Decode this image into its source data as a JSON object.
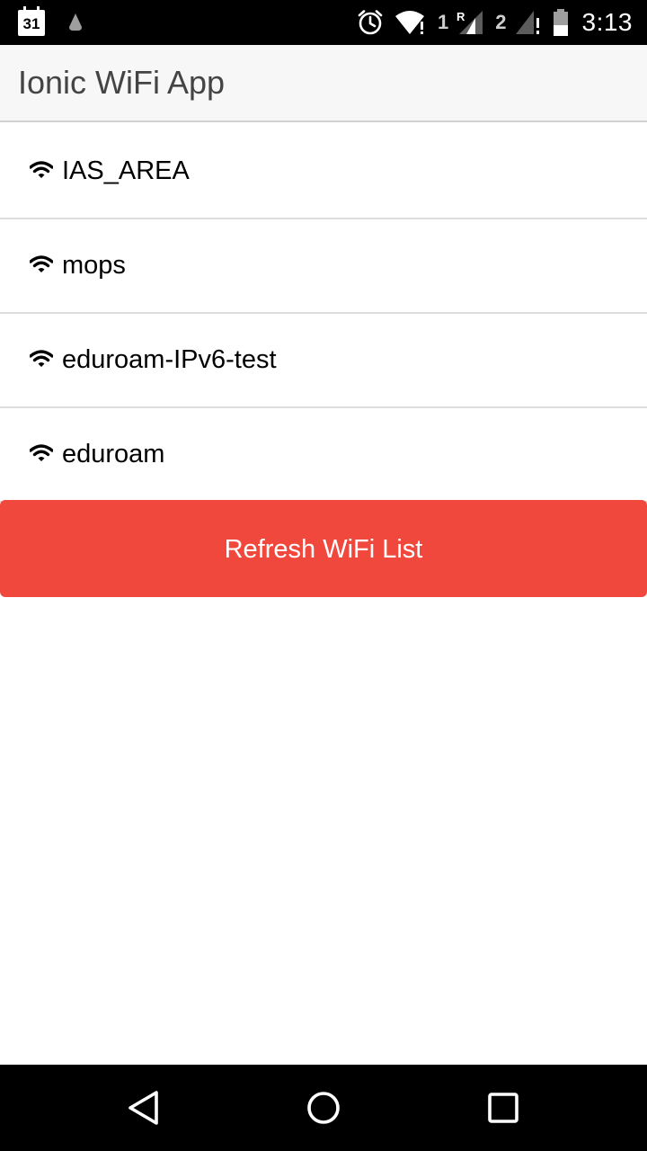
{
  "status_bar": {
    "calendar_day": "31",
    "sim1_label": "1",
    "sim1_roaming": "R",
    "sim2_label": "2",
    "time": "3:13",
    "icons": [
      "calendar-icon",
      "drive-icon",
      "alarm-icon",
      "wifi-status-icon",
      "signal-roaming-icon",
      "signal-no-service-icon",
      "battery-icon"
    ]
  },
  "header": {
    "title": "Ionic WiFi App"
  },
  "wifi_list": {
    "items": [
      {
        "ssid": "IAS_AREA"
      },
      {
        "ssid": "mops"
      },
      {
        "ssid": "eduroam-IPv6-test"
      },
      {
        "ssid": "eduroam"
      }
    ]
  },
  "refresh_button": {
    "label": "Refresh WiFi List",
    "color": "#f0483c"
  },
  "nav_bar": {
    "buttons": [
      "back-icon",
      "home-icon",
      "recents-icon"
    ]
  }
}
